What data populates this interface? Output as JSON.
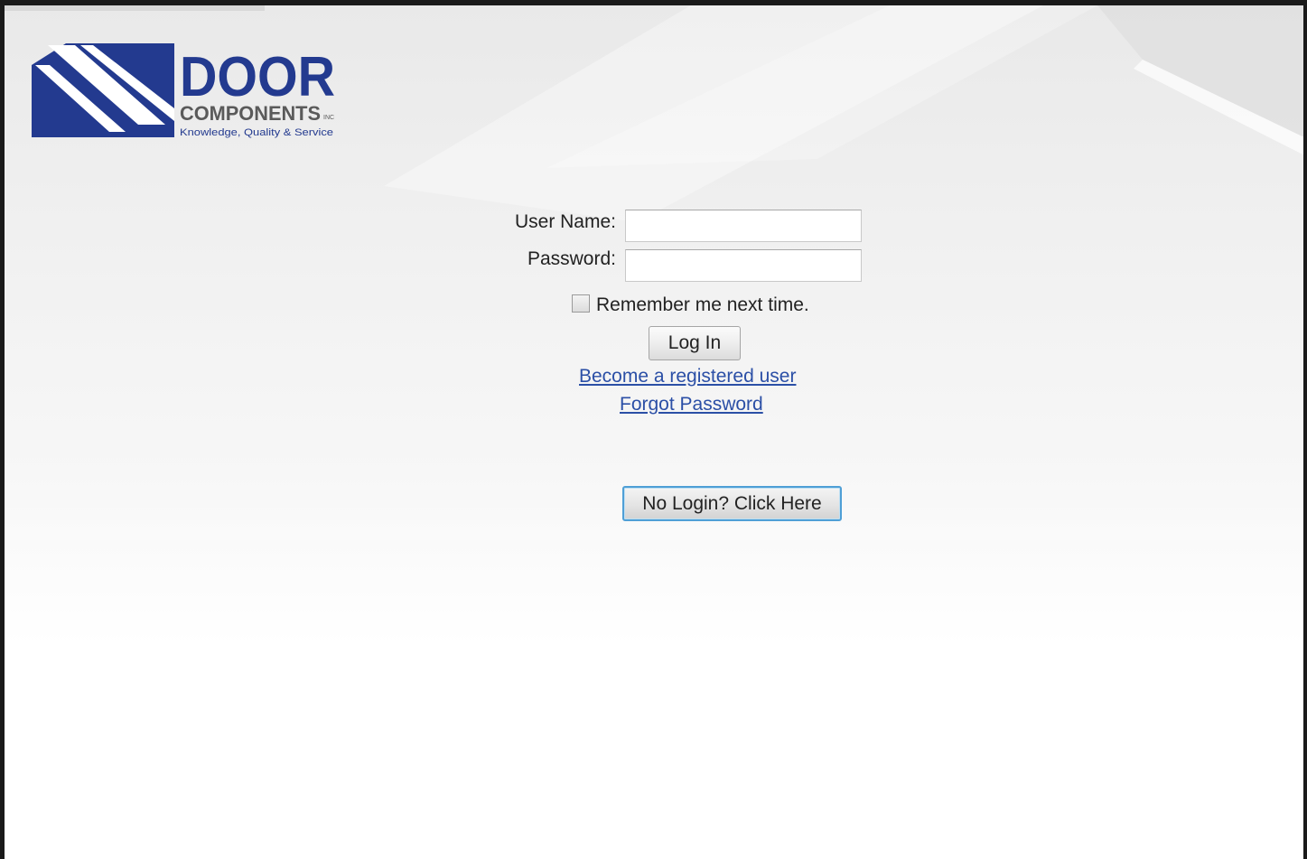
{
  "logo": {
    "word": "DOOR",
    "subword": "COMPONENTS",
    "suffix": "INC",
    "tagline": "Knowledge, Quality & Service",
    "brand_color": "#233a8f"
  },
  "login_form": {
    "username_label": "User Name:",
    "username_value": "",
    "password_label": "Password:",
    "password_value": "",
    "remember_checked": false,
    "remember_label": "Remember me next time.",
    "login_button": "Log In",
    "register_link": "Become a registered user",
    "forgot_link": "Forgot Password",
    "no_login_button": "No Login? Click Here"
  },
  "colors": {
    "link": "#2b4fa6",
    "focus_outline": "#4f9fd6"
  }
}
